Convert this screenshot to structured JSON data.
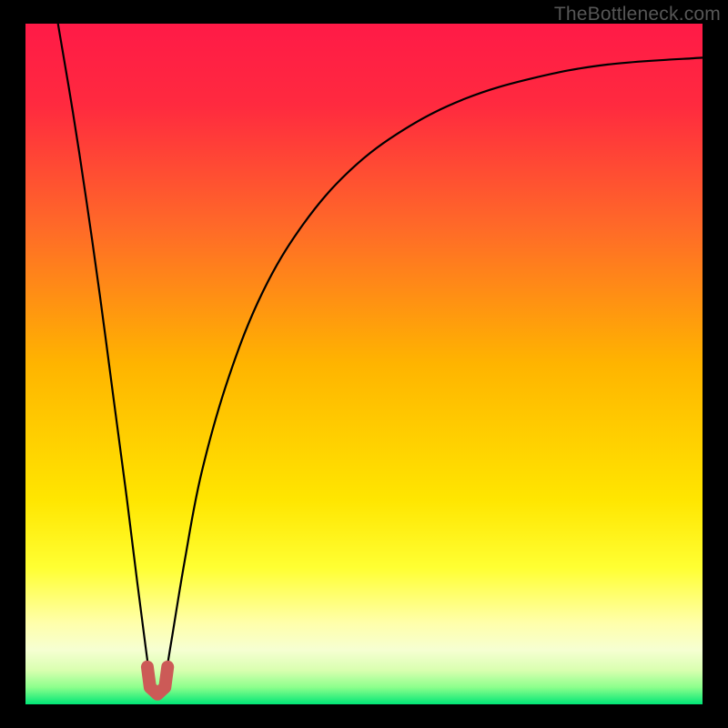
{
  "watermark": "TheBottleneck.com",
  "gradient_stops": [
    {
      "offset": 0.0,
      "color": "#ff1a47"
    },
    {
      "offset": 0.12,
      "color": "#ff2a3f"
    },
    {
      "offset": 0.3,
      "color": "#ff6a28"
    },
    {
      "offset": 0.5,
      "color": "#ffb400"
    },
    {
      "offset": 0.7,
      "color": "#ffe600"
    },
    {
      "offset": 0.8,
      "color": "#ffff33"
    },
    {
      "offset": 0.88,
      "color": "#ffffaa"
    },
    {
      "offset": 0.92,
      "color": "#f6ffd2"
    },
    {
      "offset": 0.95,
      "color": "#d9ffb0"
    },
    {
      "offset": 0.975,
      "color": "#8cff8c"
    },
    {
      "offset": 1.0,
      "color": "#00e676"
    }
  ],
  "chart_data": {
    "type": "line",
    "title": "",
    "xlabel": "",
    "ylabel": "",
    "xlim": [
      0,
      1
    ],
    "ylim": [
      0,
      1
    ],
    "x_dip": 0.195,
    "series": [
      {
        "name": "curve",
        "points": [
          {
            "x": 0.048,
            "y": 1.0
          },
          {
            "x": 0.07,
            "y": 0.87
          },
          {
            "x": 0.09,
            "y": 0.74
          },
          {
            "x": 0.11,
            "y": 0.6
          },
          {
            "x": 0.13,
            "y": 0.45
          },
          {
            "x": 0.15,
            "y": 0.3
          },
          {
            "x": 0.165,
            "y": 0.18
          },
          {
            "x": 0.178,
            "y": 0.08
          },
          {
            "x": 0.186,
            "y": 0.028
          },
          {
            "x": 0.195,
            "y": 0.018
          },
          {
            "x": 0.204,
            "y": 0.028
          },
          {
            "x": 0.215,
            "y": 0.09
          },
          {
            "x": 0.235,
            "y": 0.21
          },
          {
            "x": 0.26,
            "y": 0.34
          },
          {
            "x": 0.3,
            "y": 0.48
          },
          {
            "x": 0.35,
            "y": 0.605
          },
          {
            "x": 0.41,
            "y": 0.705
          },
          {
            "x": 0.48,
            "y": 0.785
          },
          {
            "x": 0.56,
            "y": 0.845
          },
          {
            "x": 0.65,
            "y": 0.89
          },
          {
            "x": 0.75,
            "y": 0.92
          },
          {
            "x": 0.86,
            "y": 0.94
          },
          {
            "x": 1.0,
            "y": 0.95
          }
        ]
      },
      {
        "name": "dip-marker",
        "shape": "u",
        "color": "#cc5a57",
        "points": [
          {
            "x": 0.18,
            "y": 0.055
          },
          {
            "x": 0.184,
            "y": 0.025
          },
          {
            "x": 0.195,
            "y": 0.015
          },
          {
            "x": 0.206,
            "y": 0.025
          },
          {
            "x": 0.21,
            "y": 0.055
          }
        ]
      }
    ]
  }
}
